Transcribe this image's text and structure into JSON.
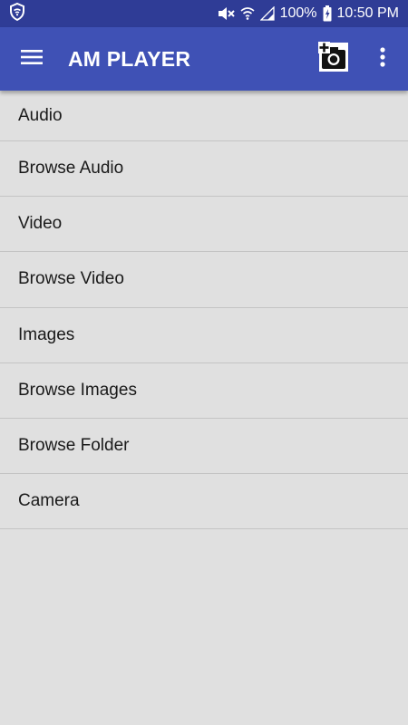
{
  "status_bar": {
    "battery": "100%",
    "time": "10:50 PM"
  },
  "app_bar": {
    "title": "AM PLAYER"
  },
  "menu": {
    "items": [
      {
        "label": "Audio"
      },
      {
        "label": "Browse Audio"
      },
      {
        "label": "Video"
      },
      {
        "label": "Browse Video"
      },
      {
        "label": "Images"
      },
      {
        "label": "Browse Images"
      },
      {
        "label": "Browse Folder"
      },
      {
        "label": "Camera"
      }
    ]
  },
  "icons": {
    "status_left": "shield-icon",
    "mute": "mute-icon",
    "wifi": "wifi-icon",
    "signal": "signal-icon",
    "battery": "battery-charging-icon",
    "menu": "hamburger-menu-icon",
    "camera": "add-camera-icon",
    "overflow": "more-vert-icon"
  },
  "colors": {
    "status_bar": "#2f3c96",
    "app_bar": "#3f51b5",
    "background": "#e0e0e0",
    "divider": "#c4c4c4",
    "text": "#1a1a1a"
  }
}
